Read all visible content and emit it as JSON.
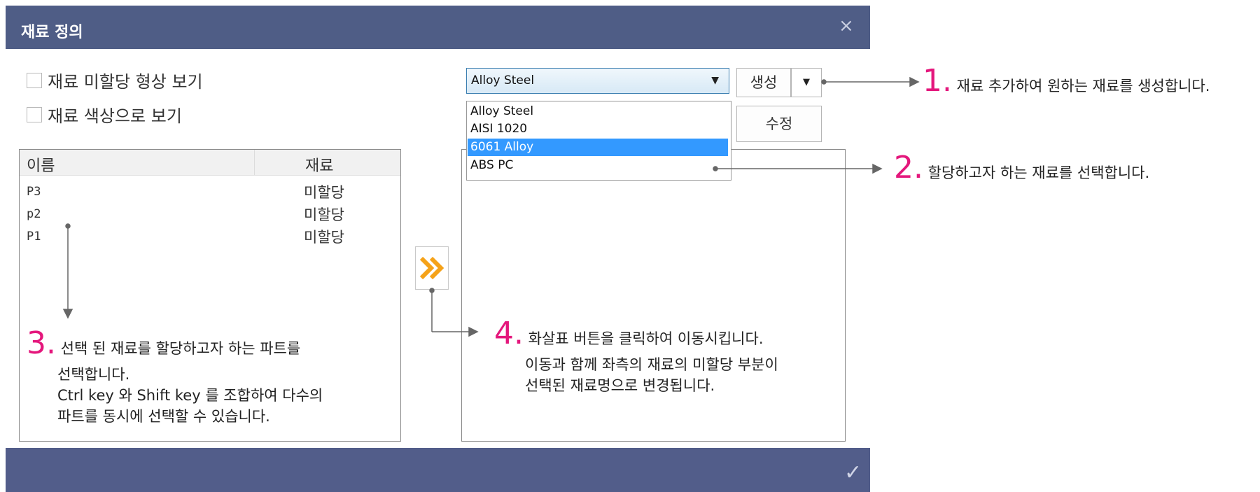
{
  "dialog": {
    "title": "재료 정의",
    "close_label": "×",
    "ok_label": "✓"
  },
  "options": {
    "show_unassigned": "재료 미할당 형상 보기",
    "show_material_color": "재료 색상으로 보기"
  },
  "parts": {
    "columns": [
      "이름",
      "재료"
    ],
    "rows": [
      {
        "name": "P3",
        "material": "미할당"
      },
      {
        "name": "p2",
        "material": "미할당"
      },
      {
        "name": "P1",
        "material": "미할당"
      }
    ]
  },
  "material": {
    "selected": "Alloy Steel",
    "options": [
      "Alloy Steel",
      "AISI 1020",
      "6061 Alloy",
      "ABS PC"
    ],
    "highlighted": "6061 Alloy",
    "create_label": "생성",
    "edit_label": "수정"
  },
  "annotations": {
    "a1_num": "1.",
    "a1_text": "재료 추가하여 원하는 재료를 생성합니다.",
    "a2_num": "2.",
    "a2_text": "할당하고자 하는 재료를 선택합니다.",
    "a3_num": "3.",
    "a3_line1": "선택 된 재료를 할당하고자 하는 파트를",
    "a3_line2": "선택합니다.",
    "a3_line3": "Ctrl key 와 Shift key 를 조합하여 다수의",
    "a3_line4": "파트를 동시에 선택할 수 있습니다.",
    "a4_num": "4.",
    "a4_line1": "화살표 버튼을 클릭하여 이동시킵니다.",
    "a4_line2": "이동과 함께 좌측의 재료의 미할당 부분이",
    "a4_line3": "선택된 재료명으로 변경됩니다."
  },
  "colors": {
    "titlebar": "#4f5d86",
    "accent_number": "#e4177c",
    "selection": "#3399ff",
    "move_arrow": "#f5a219"
  }
}
